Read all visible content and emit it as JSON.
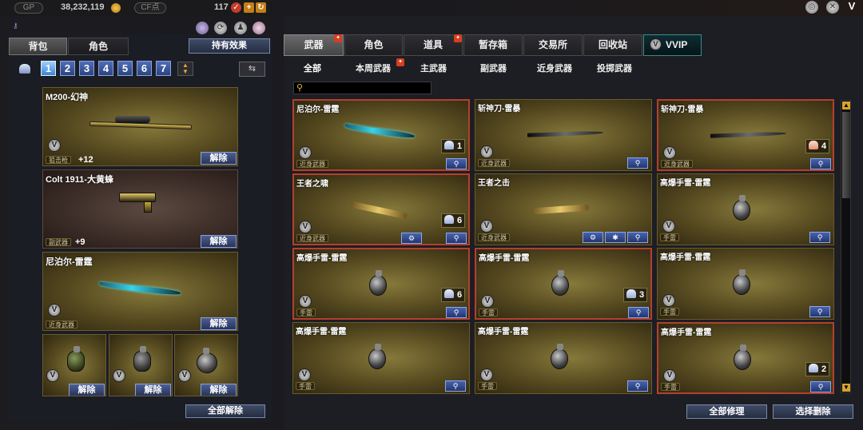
{
  "topbar": {
    "gp_label": "GP",
    "gp_value": "38,232,119",
    "cf_label": "CF点",
    "cf_value": "117",
    "plus": "+"
  },
  "left": {
    "tabs": [
      "背包",
      "角色"
    ],
    "active_tab": "背包",
    "owned_effects": "持有效果",
    "pages": [
      "1",
      "2",
      "3",
      "4",
      "5",
      "6",
      "7"
    ],
    "active_page": "1",
    "slots": [
      {
        "name": "M200-幻神",
        "type": "狙击枪",
        "extra": "+12",
        "unequip": "解除"
      },
      {
        "name": "Colt 1911-大黄蜂",
        "type": "副武器",
        "extra": "+9",
        "unequip": "解除"
      },
      {
        "name": "尼泊尔-雷霆",
        "type": "近身武器",
        "extra": "",
        "unequip": "解除"
      }
    ],
    "small_slots": [
      {
        "unequip": "解除"
      },
      {
        "unequip": "解除"
      },
      {
        "unequip": "解除"
      }
    ],
    "unequip_all": "全部解除"
  },
  "main_tabs": [
    {
      "label": "武器",
      "new": true
    },
    {
      "label": "角色",
      "new": false
    },
    {
      "label": "道具",
      "new": true
    },
    {
      "label": "暂存箱",
      "new": false
    },
    {
      "label": "交易所",
      "new": false
    },
    {
      "label": "回收站",
      "new": false
    },
    {
      "label": "VVIP",
      "new": false
    }
  ],
  "active_main_tab": "武器",
  "sub_tabs": [
    {
      "label": "全部",
      "new": false
    },
    {
      "label": "本周武器",
      "new": true
    },
    {
      "label": "主武器",
      "new": false
    },
    {
      "label": "副武器",
      "new": false
    },
    {
      "label": "近身武器",
      "new": false
    },
    {
      "label": "投掷武器",
      "new": false
    }
  ],
  "active_sub_tab": "全部",
  "search": {
    "placeholder": ""
  },
  "items": [
    {
      "name": "尼泊尔-雷霆",
      "type": "近身武器",
      "count": "1",
      "bag": "blue",
      "red": true
    },
    {
      "name": "斩神刀-雷暴",
      "type": "近身武器",
      "count": "",
      "bag": "",
      "red": false
    },
    {
      "name": "斩神刀-雷暴",
      "type": "近身武器",
      "count": "4",
      "bag": "pink",
      "red": true
    },
    {
      "name": "王者之啸",
      "type": "近身武器",
      "count": "6",
      "bag": "blue",
      "red": true
    },
    {
      "name": "王者之击",
      "type": "近身武器",
      "count": "",
      "bag": "",
      "red": false
    },
    {
      "name": "高爆手雷-雷霆",
      "type": "手雷",
      "count": "",
      "bag": "",
      "red": false
    },
    {
      "name": "高爆手雷-雷霆",
      "type": "手雷",
      "count": "6",
      "bag": "blue",
      "red": true
    },
    {
      "name": "高爆手雷-雷霆",
      "type": "手雷",
      "count": "3",
      "bag": "blue",
      "red": true
    },
    {
      "name": "高爆手雷-雷霆",
      "type": "手雷",
      "count": "",
      "bag": "",
      "red": false
    },
    {
      "name": "高爆手雷-雷霆",
      "type": "手雷",
      "count": "",
      "bag": "",
      "red": false
    },
    {
      "name": "高爆手雷-雷霆",
      "type": "手雷",
      "count": "",
      "bag": "",
      "red": false
    },
    {
      "name": "高爆手雷-雷霆",
      "type": "手雷",
      "count": "2",
      "bag": "blue",
      "red": true
    }
  ],
  "bottom": {
    "repair_all": "全部修理",
    "select_delete": "选择删除"
  },
  "colors": {
    "accent_red": "#b3402e",
    "button_blue": "#2c437f",
    "card_gold": "#86793b"
  },
  "icons": {
    "vvip": "v-badge-icon",
    "search": "magnifier-icon",
    "bag": "bag-icon",
    "new": "gift-icon"
  }
}
